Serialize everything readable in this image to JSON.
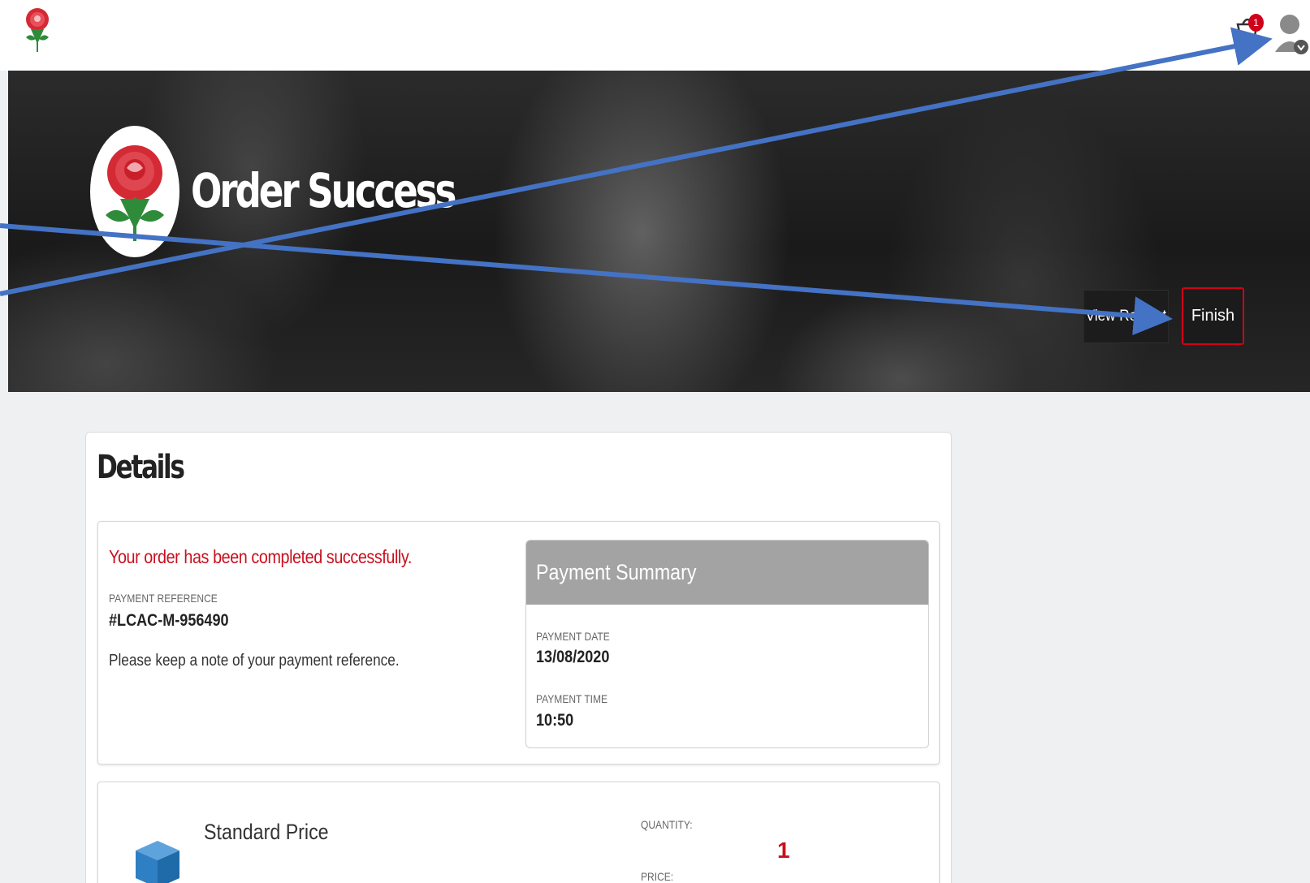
{
  "header": {
    "basket_count": "1",
    "icons": [
      "england-rose-logo",
      "basket-icon",
      "user-avatar-icon",
      "chevron-down-icon"
    ]
  },
  "hero": {
    "title": "Order Success",
    "view_receipt_label": "View Receipt",
    "finish_label": "Finish"
  },
  "details": {
    "title": "Details",
    "success_message": "Your order has been completed successfully.",
    "payment_reference_label": "PAYMENT REFERENCE",
    "payment_reference": "#LCAC-M-956490",
    "reference_note": "Please keep a note of your payment reference.",
    "summary": {
      "title": "Payment Summary",
      "payment_date_label": "PAYMENT DATE",
      "payment_date": "13/08/2020",
      "payment_time_label": "PAYMENT TIME",
      "payment_time": "10:50"
    },
    "item": {
      "name": "Standard Price",
      "quantity_label": "QUANTITY:",
      "quantity": "1",
      "price_label": "PRICE:"
    }
  },
  "colors": {
    "accent_red": "#d0021b",
    "annotation_blue": "#4472c4",
    "summary_header": "#a3a3a3"
  }
}
